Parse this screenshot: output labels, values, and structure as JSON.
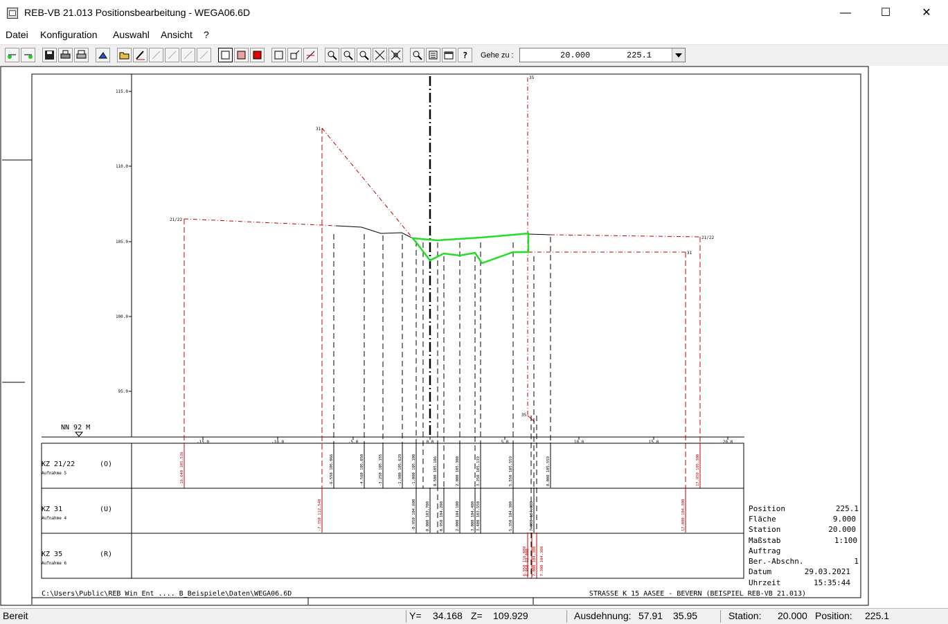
{
  "window": {
    "title": "REB-VB 21.013 Positionsbearbeitung - WEGA06.6D",
    "minimize": "—",
    "maximize": "☐",
    "close": "✕"
  },
  "menu": [
    {
      "label": "Datei"
    },
    {
      "label": "Konfiguration"
    },
    {
      "label": "Auswahl"
    },
    {
      "label": "Ansicht"
    },
    {
      "label": "?"
    }
  ],
  "toolbar": {
    "goto_label": "Gehe zu :",
    "goto_station": "20.000",
    "goto_position": "225.1"
  },
  "colors": {
    "red": "#c00000",
    "green": "#22dd22",
    "black": "#000000"
  },
  "drawing": {
    "y_axis_ticks": [
      "115.0",
      "110.0",
      "105.0",
      "100.0",
      "95.0"
    ],
    "x_axis_ticks": [
      "-15.0",
      "-10.0",
      "-5.0",
      "0.0",
      "5.0",
      "10.0",
      "15.0",
      "20.0"
    ],
    "datum_label": "NN  92 M",
    "point_labels": [
      "21/22",
      "31",
      "35",
      "21/22",
      "31",
      "35"
    ],
    "rows": [
      {
        "name": "KZ 21/22",
        "code": "(O)",
        "sub": "Aufnahme 5",
        "values": [
          "-16.640 105.536",
          "-6.550 105.066",
          "-4.560 105.050",
          "-3.250 105.155",
          "-1.900 105.629",
          "-1.000 105.108",
          "0.500 105.106",
          "2.000 105.300",
          "3.350 105.139",
          "5.550 105.559",
          "8.000 105.559",
          "17.950 105.300"
        ]
      },
      {
        "name": "KZ 31",
        "code": "(U)",
        "sub": "Aufnahme 4",
        "values": [
          "-7.350 112.540",
          "-0.950 104.600",
          "0.000 103.700",
          "0.950 104.200",
          "2.000 104.100",
          "3.000 104.400",
          "3.400 103.550",
          "5.350 104.300",
          "7.000 104.300",
          "17.000 104.300"
        ]
      },
      {
        "name": "KZ 35",
        "code": "(R)",
        "sub": "Aufnahme 6",
        "values": [
          "6.950 116.000",
          "6.950 93.800",
          "7.000 104.300",
          "7.300 104.300"
        ]
      }
    ],
    "info": [
      {
        "label": "Position",
        "value": "225.1"
      },
      {
        "label": "Fläche",
        "value": "9.000"
      },
      {
        "label": "Station",
        "value": "20.000"
      },
      {
        "label": "Maßstab",
        "value": "1:100"
      },
      {
        "label": "Auftrag",
        "value": ""
      },
      {
        "label": "Ber.-Abschn.",
        "value": "1"
      },
      {
        "label": "Datum",
        "value": "29.03.2021"
      },
      {
        "label": "Uhrzeit",
        "value": "15:35:44"
      }
    ],
    "footer_path": "C:\\Users\\Public\\REB Win Ent .... B_Beispiele\\Daten\\WEGA06.6D",
    "footer_project": "STRASSE K 15   AASEE - BEVERN (BEISPIEL REB-VB 21.013)"
  },
  "status": {
    "ready": "Bereit",
    "y_label": "Y=",
    "y_value": "34.168",
    "z_label": "Z=",
    "z_value": "109.929",
    "extent_label": "Ausdehnung:",
    "extent_x": "57.91",
    "extent_y": "35.95",
    "station_label": "Station:",
    "station_value": "20.000",
    "position_label": "Position:",
    "position_value": "225.1"
  }
}
